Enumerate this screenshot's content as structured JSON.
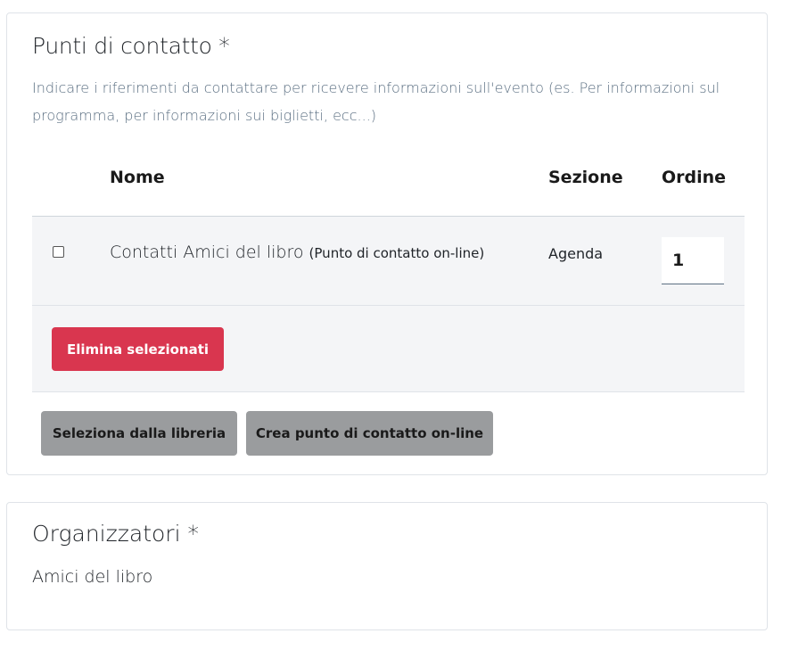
{
  "contact_points": {
    "title": "Punti di contatto *",
    "help_text": "Indicare i riferimenti da contattare per ricevere informazioni sull'evento (es. Per informazioni sul programma, per informazioni sui biglietti, ecc...)",
    "table": {
      "headers": [
        "Nome",
        "Sezione",
        "Ordine"
      ],
      "rows": [
        {
          "checked": false,
          "name": "Contatti Amici del libro",
          "type": "(Punto di contatto on-line)",
          "section": "Agenda",
          "order": "1"
        }
      ]
    },
    "delete_selected_label": "Elimina selezionati",
    "select_from_library_label": "Seleziona dalla libreria",
    "create_online_contact_label": "Crea punto di contatto on-line"
  },
  "organizers": {
    "title": "Organizzatori *",
    "value": "Amici del libro"
  },
  "colors": {
    "danger": "#d9364f",
    "secondary_button": "#9a9c9e",
    "row_background": "#f4f5f7",
    "help_text": "#5b6f82"
  }
}
